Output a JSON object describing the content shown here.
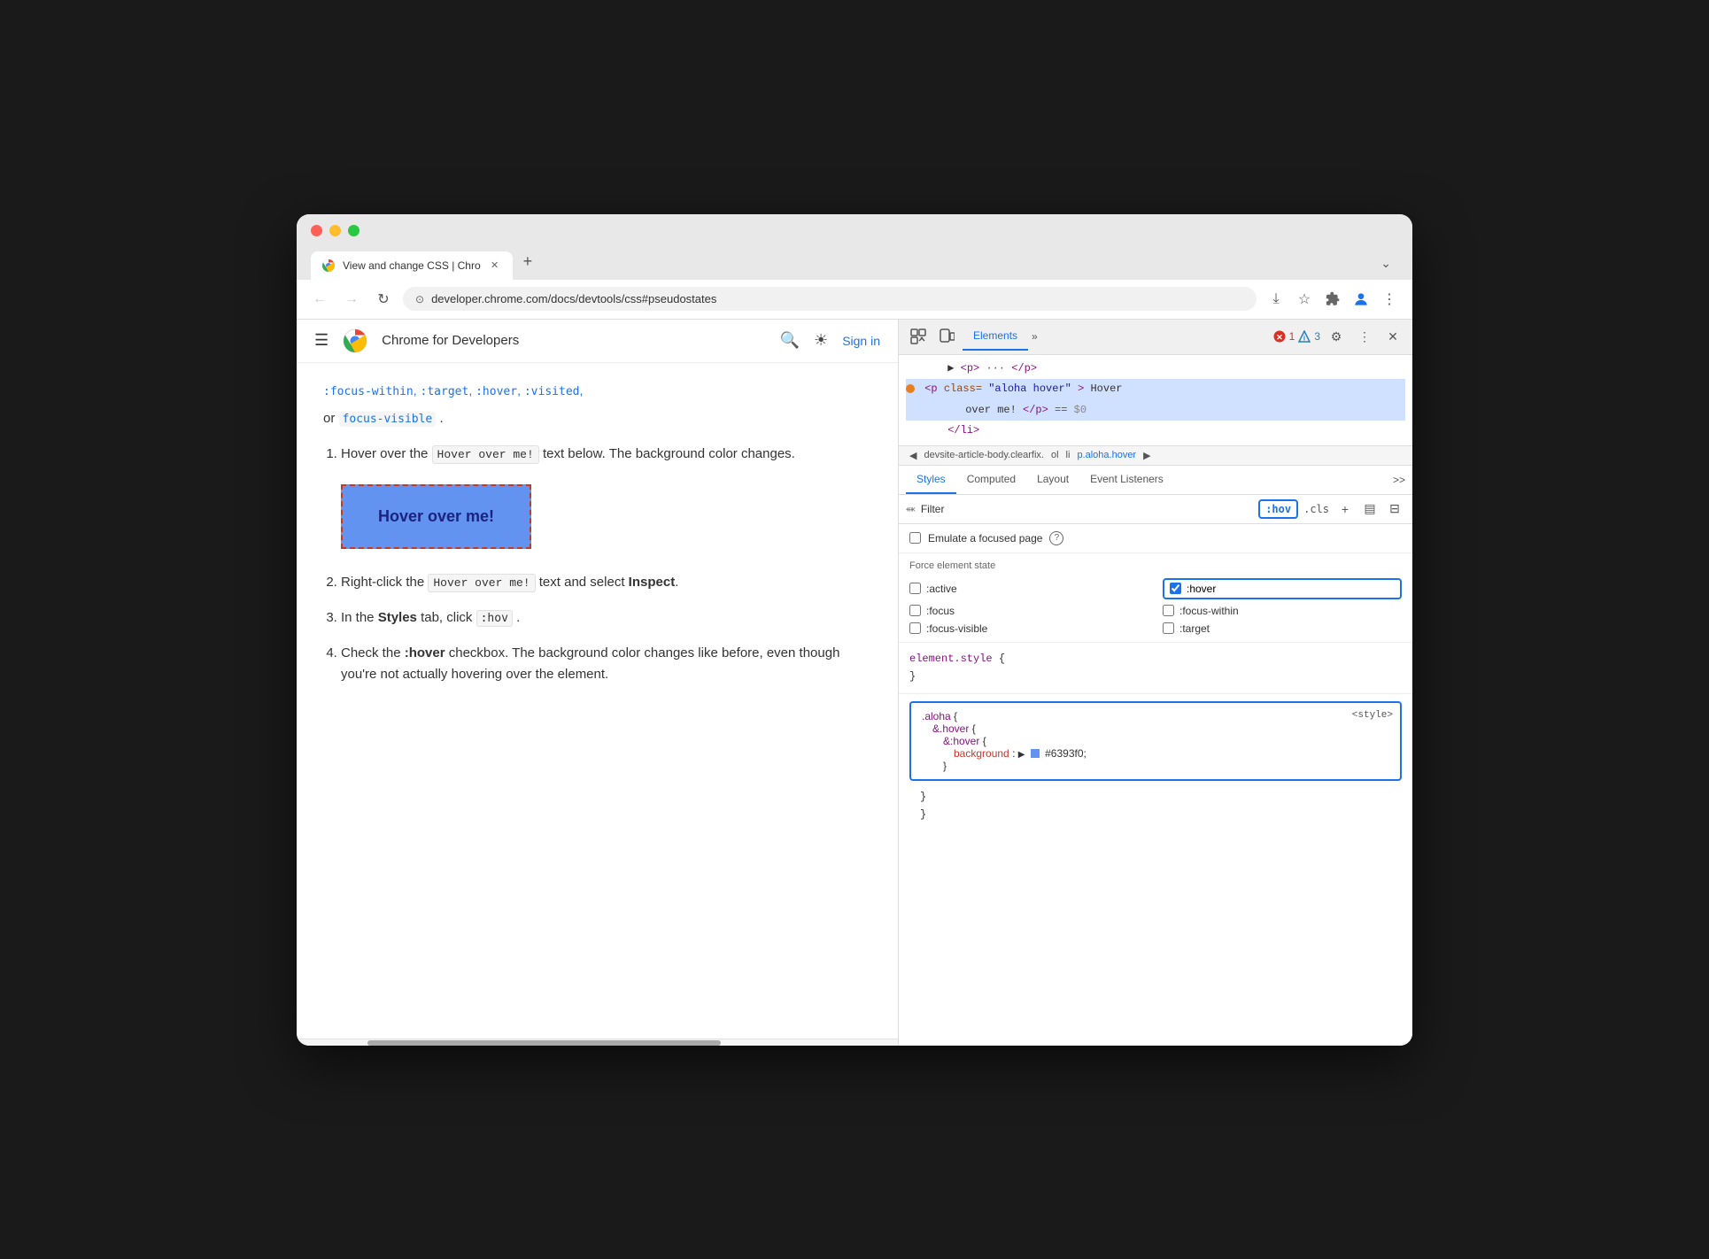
{
  "browser": {
    "tab_title": "View and change CSS | Chro",
    "tab_new_label": "+",
    "tab_menu_label": "⌄",
    "back_label": "←",
    "forward_label": "→",
    "reload_label": "↻",
    "address": "developer.chrome.com/docs/devtools/css#pseudostates",
    "download_icon": "⤓",
    "bookmark_icon": "☆",
    "extensions_icon": "🧩",
    "profile_icon": "👤",
    "menu_icon": "⋮"
  },
  "webpage": {
    "header": {
      "site_name": "Chrome for Developers",
      "search_icon": "search",
      "theme_icon": "☀",
      "signin_label": "Sign in"
    },
    "prev_text_parts": [
      ":focus-within, :target, :hover, :visited,"
    ],
    "focus_visible_text": "focus-visible",
    "or_text": "or",
    "dot_text": ".",
    "steps": [
      {
        "num": "1.",
        "text_before": "Hover over the",
        "code": "Hover over me!",
        "text_after": "text below. The background color changes."
      },
      {
        "num": "2.",
        "text_before": "Right-click the",
        "code": "Hover over me!",
        "text_after": "text and select",
        "bold": "Inspect",
        "dot": "."
      },
      {
        "num": "3.",
        "text_before": "In the",
        "bold": "Styles",
        "text_middle": "tab, click",
        "code": ":hov",
        "text_after": "."
      },
      {
        "num": "4.",
        "text_before": "Check the",
        "bold": ":hover",
        "text_after": "checkbox. The background color changes like before, even though you're not actually hovering over the element."
      }
    ],
    "hover_box_label": "Hover over me!",
    "scrollbar_visible": true
  },
  "devtools": {
    "toolbar": {
      "inspect_icon": "⬚",
      "device_icon": "▭",
      "elements_tab": "Elements",
      "more_tabs_label": "»",
      "error_count": "1",
      "warning_count": "3",
      "settings_icon": "⚙",
      "more_menu_icon": "⋮",
      "close_icon": "✕"
    },
    "dom": {
      "line1": "▶ <p> ··· </p>",
      "line2_open": "<p class=\"aloha hover\">Hover",
      "line2_text": "over me!</p>",
      "line2_eq": "== $0",
      "line3": "</li>"
    },
    "breadcrumb": {
      "items": [
        "devsite-article-body.clearfix.",
        "ol",
        "li",
        "p.aloha.hover"
      ],
      "left_arrow": "◀",
      "right_arrow": "▶"
    },
    "panels": {
      "styles_tab": "Styles",
      "computed_tab": "Computed",
      "layout_tab": "Layout",
      "event_listeners_tab": "Event Listeners",
      "more_label": ">>"
    },
    "filter": {
      "icon": "🔽",
      "placeholder": "Filter",
      "hov_badge": ":hov",
      "cls_badge": ".cls",
      "plus_icon": "+",
      "new_style_icon": "▤",
      "toggle_icon": "⊟"
    },
    "emulate": {
      "label": "Emulate a focused page",
      "info_label": "?"
    },
    "force_state": {
      "title": "Force element state",
      "states": [
        {
          "id": "active",
          "label": ":active",
          "checked": false
        },
        {
          "id": "hover",
          "label": ":hover",
          "checked": true
        },
        {
          "id": "focus",
          "label": ":focus",
          "checked": false
        },
        {
          "id": "focus-within",
          "label": ":focus-within",
          "checked": false
        },
        {
          "id": "focus-visible",
          "label": ":focus-visible",
          "checked": false
        },
        {
          "id": "target",
          "label": ":target",
          "checked": false
        }
      ]
    },
    "css_rules": {
      "element_style": "element.style {",
      "element_style_close": "}",
      "rule1": {
        "selector": ".aloha {",
        "nested1_selector": "&.hover {",
        "nested2_selector": "&:hover {",
        "prop": "background",
        "colon": ":",
        "color_val": "#6393f0",
        "close_nested2": "}",
        "close_nested1": "}",
        "close_rule": "}",
        "source": "<style>"
      },
      "bottom_close1": "}",
      "bottom_close2": "}"
    }
  }
}
